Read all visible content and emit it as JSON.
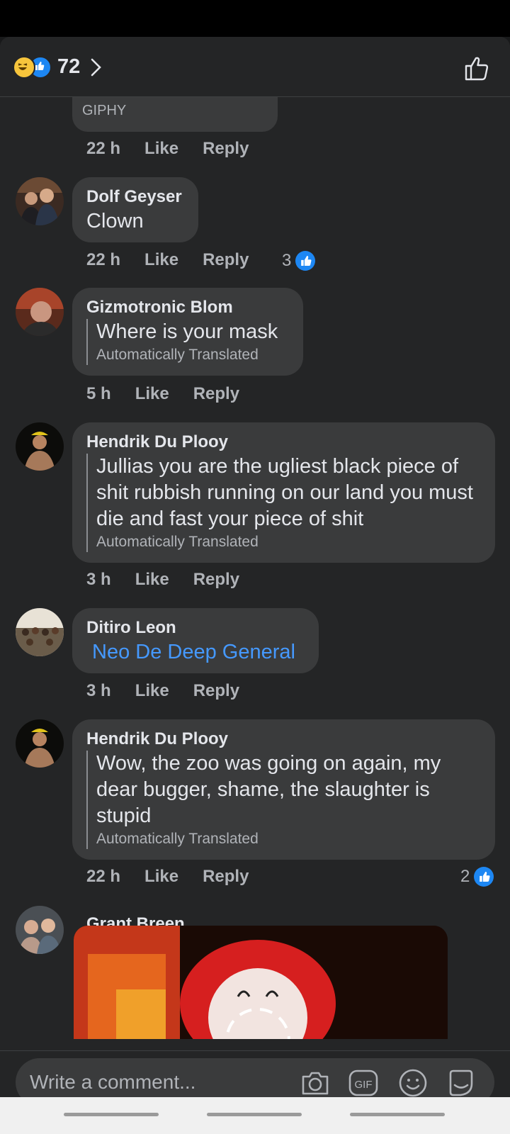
{
  "header": {
    "reaction_count": "72"
  },
  "giphy": {
    "label": "GIPHY"
  },
  "first_meta": {
    "time": "22 h",
    "like": "Like",
    "reply": "Reply"
  },
  "comments": [
    {
      "author": "Dolf Geyser",
      "text": "Clown",
      "time": "22 h",
      "like": "Like",
      "reply": "Reply",
      "reactions": "3"
    },
    {
      "author": "Gizmotronic Blom",
      "text": "Where is your mask",
      "auto": "Automatically Translated",
      "time": "5 h",
      "like": "Like",
      "reply": "Reply"
    },
    {
      "author": "Hendrik Du Plooy",
      "text": "Jullias you are the ugliest black piece of shit rubbish running on our land you must die and fast your piece of shit",
      "auto": "Automatically Translated",
      "time": "3 h",
      "like": "Like",
      "reply": "Reply"
    },
    {
      "author": "Ditiro Leon",
      "mention": "Neo De Deep General",
      "time": "3 h",
      "like": "Like",
      "reply": "Reply"
    },
    {
      "author": "Hendrik Du Plooy",
      "text": "Wow, the zoo was going on again, my dear bugger, shame, the slaughter is stupid",
      "auto": "Automatically Translated",
      "time": "22 h",
      "like": "Like",
      "reply": "Reply",
      "reactions": "2"
    },
    {
      "author": "Grant Breen"
    }
  ],
  "composer": {
    "placeholder": "Write a comment..."
  },
  "colors": {
    "background": "#242526",
    "bubble": "#3a3b3c",
    "accent": "#1d87f3",
    "mention": "#4599ff"
  }
}
